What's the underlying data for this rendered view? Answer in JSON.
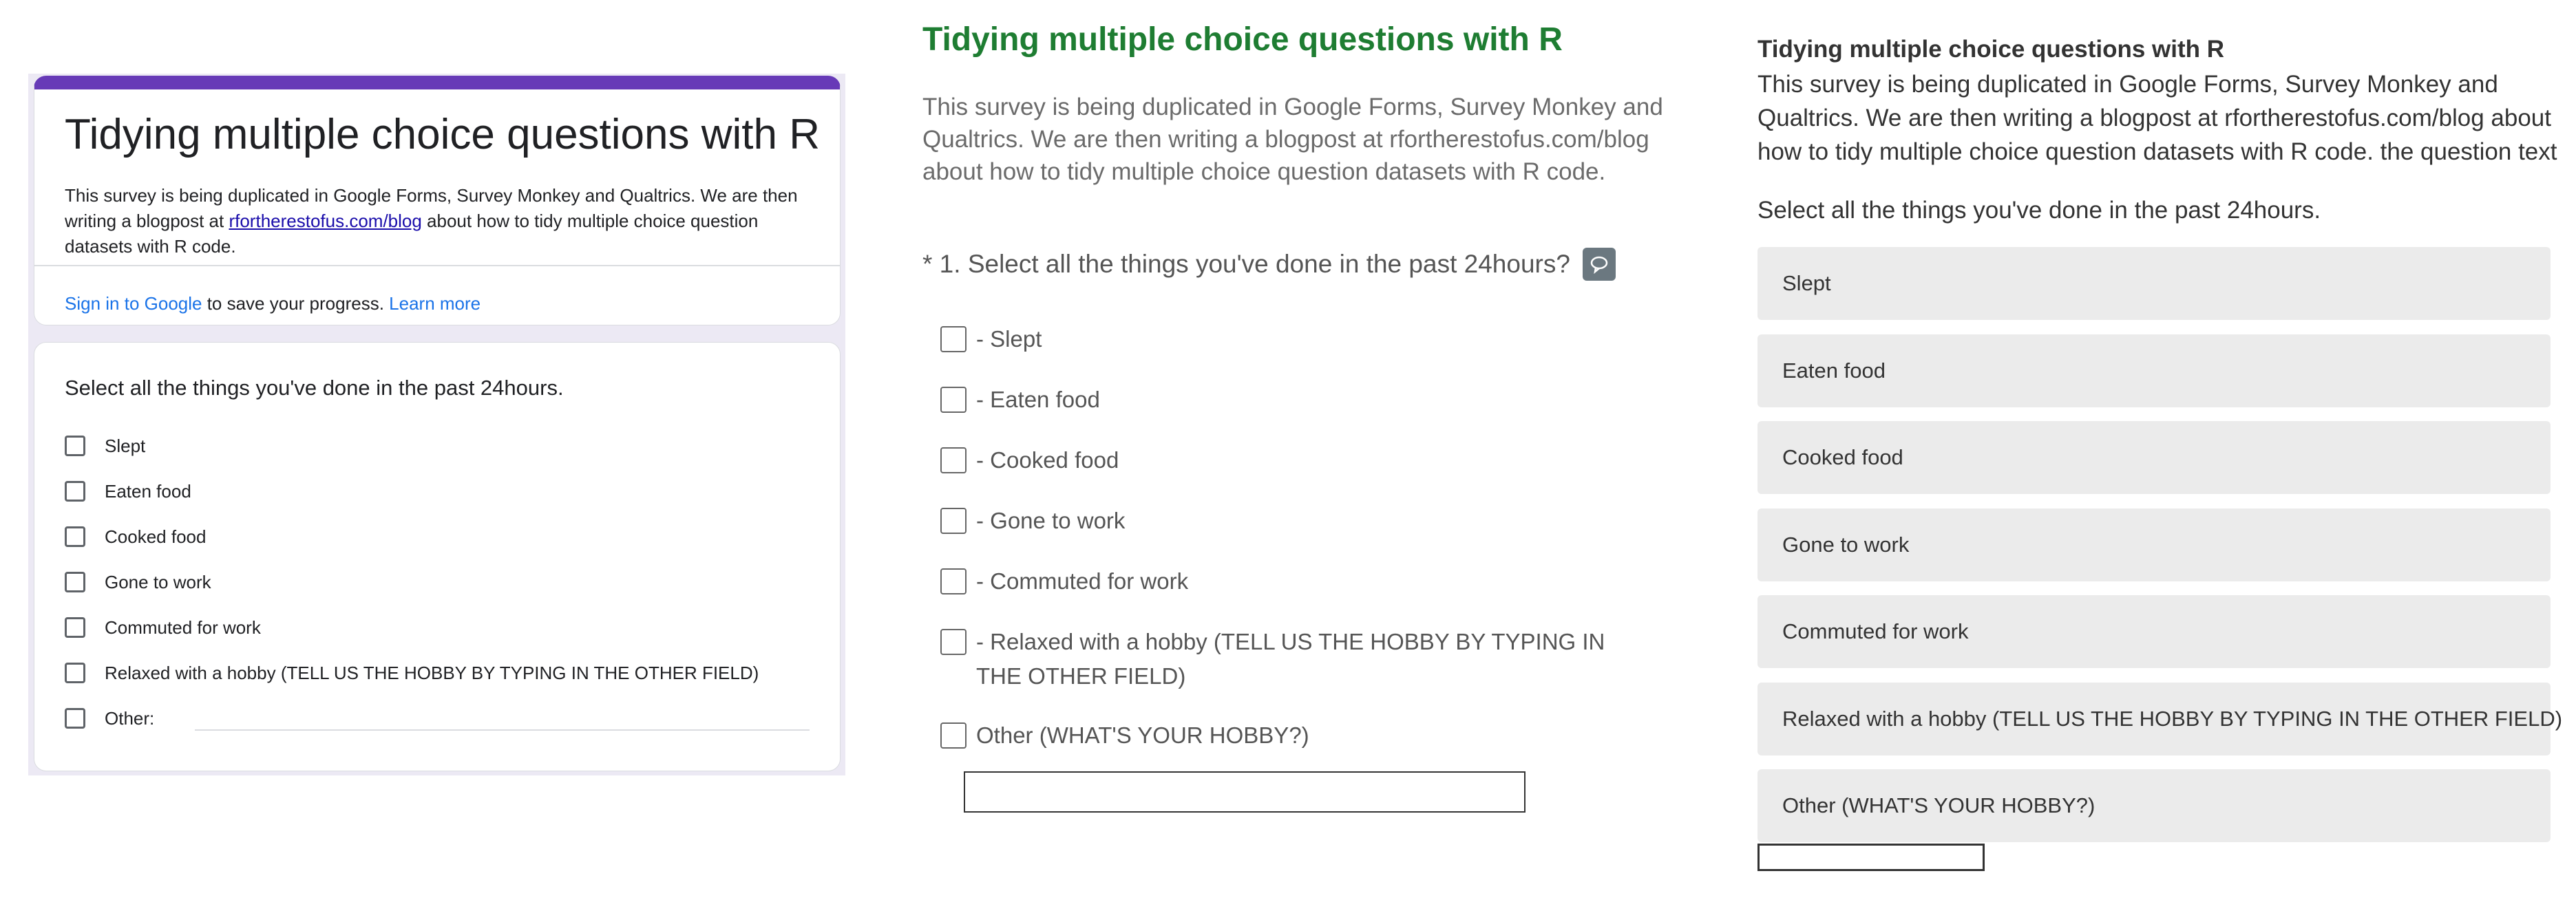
{
  "google_forms": {
    "title": "Tidying multiple choice questions with R",
    "description_before_link": "This survey is being duplicated in Google Forms, Survey Monkey and Qualtrics. We are then writing a blogpost at ",
    "description_link": "rfortherestofus.com/blog",
    "description_after_link": " about how to tidy multiple choice question datasets with R code.",
    "sign_in_link": "Sign in to Google",
    "sign_in_text": " to save your progress. ",
    "learn_more": "Learn more",
    "question": "Select all the things you've done in the past 24hours.",
    "options": [
      "Slept",
      "Eaten food",
      "Cooked food",
      "Gone to work",
      "Commuted for work",
      "Relaxed with a hobby (TELL US THE HOBBY BY TYPING IN THE OTHER FIELD)",
      "Other:"
    ],
    "accent_color": "#673ab7"
  },
  "surveymonkey": {
    "title": "Tidying multiple choice questions with R",
    "description": "This survey is being duplicated in Google Forms, Survey Monkey and Qualtrics. We are then writing a blogpost at rfortherestofus.com/blog about how to tidy multiple choice question datasets with R code.",
    "question": "* 1. Select all the things you've done in the past 24hours?",
    "comment_icon": "comment-icon",
    "options": [
      "- Slept",
      "- Eaten food",
      "- Cooked food",
      "- Gone to work",
      "- Commuted for work",
      "- Relaxed with a hobby (TELL US THE HOBBY BY TYPING IN THE OTHER FIELD)",
      "Other (WHAT'S YOUR HOBBY?)"
    ],
    "title_color": "#1e7d32"
  },
  "qualtrics": {
    "title": "Tidying multiple choice questions with R",
    "description": "This survey is being duplicated in Google Forms, Survey Monkey and Qualtrics. We are then writing a blogpost at rfortherestofus.com/blog about how to tidy multiple choice question datasets with R code. the question text",
    "question": "Select all the things you've done in the past 24hours.",
    "options": [
      "Slept",
      "Eaten food",
      "Cooked food",
      "Gone to work",
      "Commuted for work",
      "Relaxed with a hobby (TELL US THE HOBBY BY TYPING IN THE OTHER FIELD)",
      "Other (WHAT'S YOUR HOBBY?)"
    ]
  }
}
